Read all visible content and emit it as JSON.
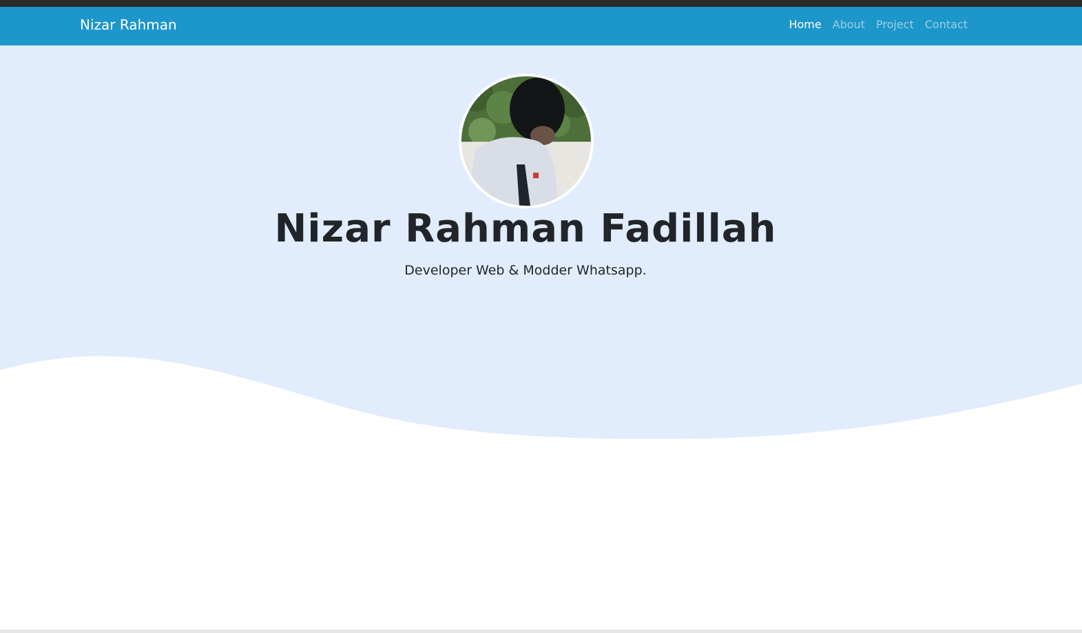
{
  "navbar": {
    "brand": "Nizar Rahman",
    "links": [
      {
        "label": "Home",
        "active": true
      },
      {
        "label": "About",
        "active": false
      },
      {
        "label": "Project",
        "active": false
      },
      {
        "label": "Contact",
        "active": false
      }
    ]
  },
  "hero": {
    "name": "Nizar Rahman Fadillah",
    "tagline": "Developer Web & Modder Whatsapp."
  },
  "colors": {
    "navbar": "#1d96c9",
    "hero_background": "#e1ecfd",
    "text": "#212529"
  }
}
